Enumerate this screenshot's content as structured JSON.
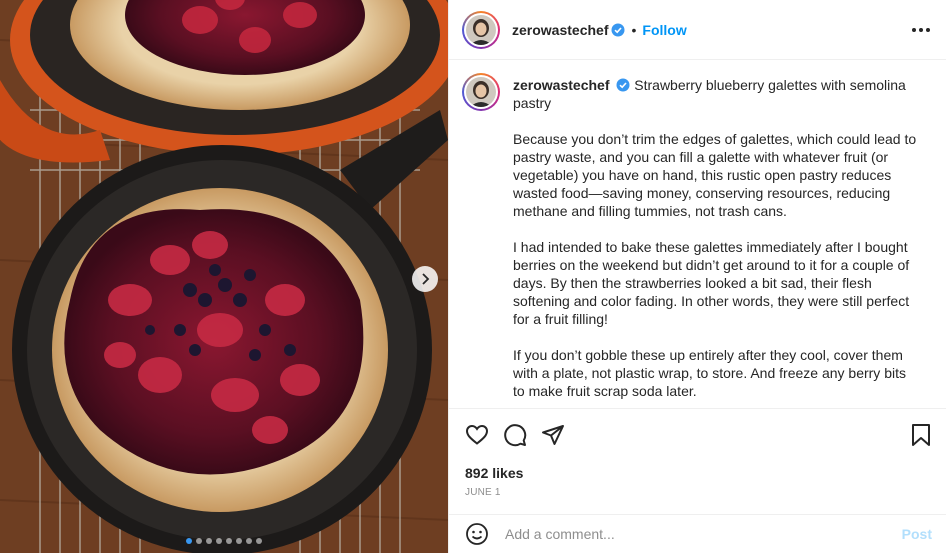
{
  "post": {
    "username": "zerowastechef",
    "follow_label": "Follow",
    "separator": "•",
    "caption_title": "Strawberry blueberry galettes with semolina pastry",
    "paragraphs": [
      "Because you don’t trim the edges of galettes, which could lead to pastry waste, and you can fill a galette with whatever fruit (or vegetable) you have on hand, this rustic open pastry reduces wasted food—saving money, conserving resources, reducing methane and filling tummies, not trash cans.",
      "I had intended to bake these galettes immediately after I bought berries on the weekend but didn’t get around to it for a couple of days. By then the strawberries looked a bit sad, their flesh softening and color fading. In other words, they were still perfect for a fruit filling!",
      "If you don’t gobble these up entirely after they cool, cover them with a plate, not plastic wrap, to store. And freeze any berry bits to make fruit scrap soda later."
    ],
    "likes": "892 likes",
    "date": "JUNE 1",
    "comment_placeholder": "Add a comment...",
    "post_label": "Post"
  },
  "carousel": {
    "total": 8,
    "current": 1
  },
  "icons": {
    "verified": "verified-badge-icon",
    "more": "more-options-icon",
    "like": "heart-icon",
    "comment": "comment-bubble-icon",
    "share": "paper-plane-icon",
    "save": "bookmark-icon",
    "emoji": "emoji-smiley-icon",
    "next": "chevron-right-icon"
  },
  "colors": {
    "link": "#0095f6",
    "verified": "#3897f0",
    "post_disabled": "#b2dffc",
    "muted": "#8e8e8e"
  }
}
